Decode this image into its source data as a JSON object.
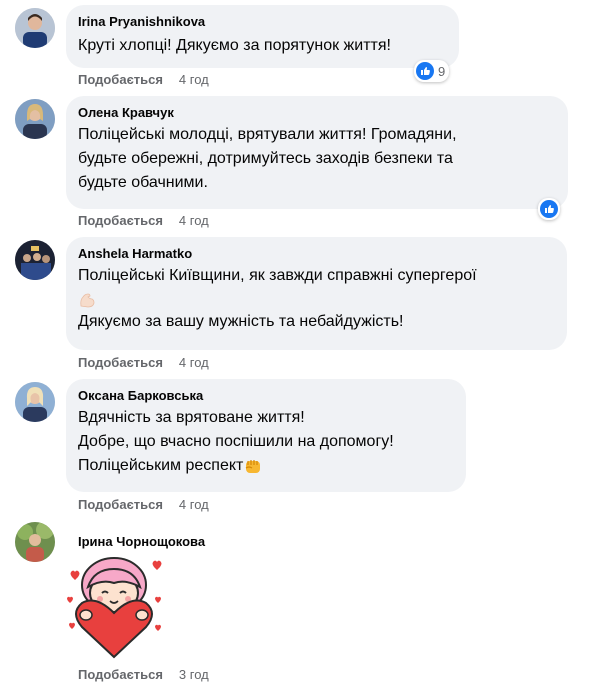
{
  "comments": [
    {
      "author": "Irina Pryanishnikova",
      "lines": [
        "Круті хлопці! Дякуємо за порятунок життя!"
      ],
      "like_label": "Подобається",
      "time": "4 год",
      "reaction_count": "9",
      "avatar_icon": "avatar-photo"
    },
    {
      "author": "Олена Кравчук",
      "lines": [
        "Поліцейські молодці, врятували життя! Громадяни,",
        "будьте обережні, дотримуйтесь заходів безпеки та",
        "будьте обачними."
      ],
      "like_label": "Подобається",
      "time": "4 год",
      "avatar_icon": "avatar-photo"
    },
    {
      "author": "Anshela Harmatko",
      "lines": [
        "Поліцейські Київщини, як завжди справжні супергерої",
        "Дякуємо за вашу мужність та небайдужість!"
      ],
      "like_label": "Подобається",
      "time": "4 год",
      "avatar_icon": "avatar-photo",
      "emoji": "flexed-biceps-emoji"
    },
    {
      "author": "Оксана Барковська",
      "lines": [
        "Вдячність за врятоване життя!",
        "Добре, що вчасно поспішили на допомогу!",
        "Поліцейським респект"
      ],
      "like_label": "Подобається",
      "time": "4 год",
      "avatar_icon": "avatar-photo",
      "emoji": "fist-emoji"
    },
    {
      "author": "Ірина Чорнощокова",
      "like_label": "Подобається",
      "time": "3 год",
      "avatar_icon": "avatar-photo",
      "sticker": "girl-hugging-heart-sticker"
    }
  ],
  "colors": {
    "bubble": "#f0f2f5",
    "like_blue": "#1877f2",
    "meta_text": "#65676b"
  }
}
